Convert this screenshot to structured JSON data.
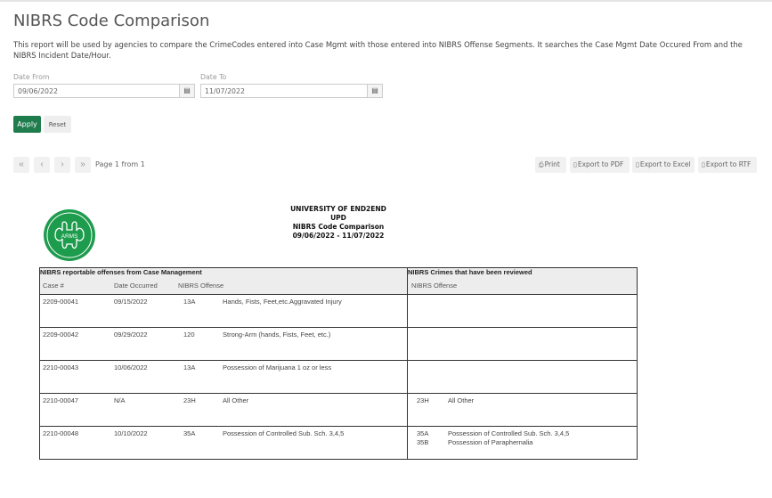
{
  "page": {
    "title": "NIBRS Code Comparison",
    "description": "This report will be used by agencies to compare the CrimeCodes entered into Case Mgmt with those entered into NIBRS Offense Segments. It searches the Case Mgmt Date Occured From and the NIBRS Incident Date/Hour."
  },
  "filters": {
    "date_from_label": "Date From",
    "date_from_value": "09/06/2022",
    "date_to_label": "Date To",
    "date_to_value": "11/07/2022",
    "apply_label": "Apply",
    "reset_label": "Reset"
  },
  "pager": {
    "first": "«",
    "prev": "‹",
    "next": "›",
    "last": "»",
    "page_info": "Page 1 from 1"
  },
  "export": {
    "print": "Print",
    "pdf": "Export to PDF",
    "excel": "Export to Excel",
    "rtf": "Export to RTF"
  },
  "logo": {
    "text": "ARMS",
    "color": "#1e9c4d"
  },
  "report": {
    "org": "UNIVERSITY OF END2END",
    "dept": "UPD",
    "name": "NIBRS Code Comparison",
    "range": "09/06/2022 - 11/07/2022",
    "left_header": "NIBRS reportable offenses from Case Management",
    "right_header": "NIBRS Crimes that have been reviewed",
    "col_case": "Case #",
    "col_date": "Date Occurred",
    "col_offense": "NIBRS Offense",
    "col_r_offense": "NIBRS Offense",
    "rows": [
      {
        "case": "2209-00041",
        "date": "09/15/2022",
        "code": "13A",
        "desc": "Hands, Fists, Feet,etc.Aggravated Injury",
        "reviewed": []
      },
      {
        "case": "2209-00042",
        "date": "09/29/2022",
        "code": "120",
        "desc": "Strong-Arm (hands, Fists, Feet, etc.)",
        "reviewed": []
      },
      {
        "case": "2210-00043",
        "date": "10/06/2022",
        "code": "13A",
        "desc": "Possession of Marijuana 1 oz or less",
        "reviewed": []
      },
      {
        "case": "2210-00047",
        "date": "N/A",
        "code": "23H",
        "desc": "All Other",
        "reviewed": [
          {
            "code": "23H",
            "desc": "All Other"
          }
        ]
      },
      {
        "case": "2210-00048",
        "date": "10/10/2022",
        "code": "35A",
        "desc": "Possession of Controlled Sub. Sch. 3,4,5",
        "reviewed": [
          {
            "code": "35A",
            "desc": "Possession of Controlled Sub. Sch. 3,4,5"
          },
          {
            "code": "35B",
            "desc": "Possession of Paraphernalia"
          }
        ]
      }
    ]
  }
}
